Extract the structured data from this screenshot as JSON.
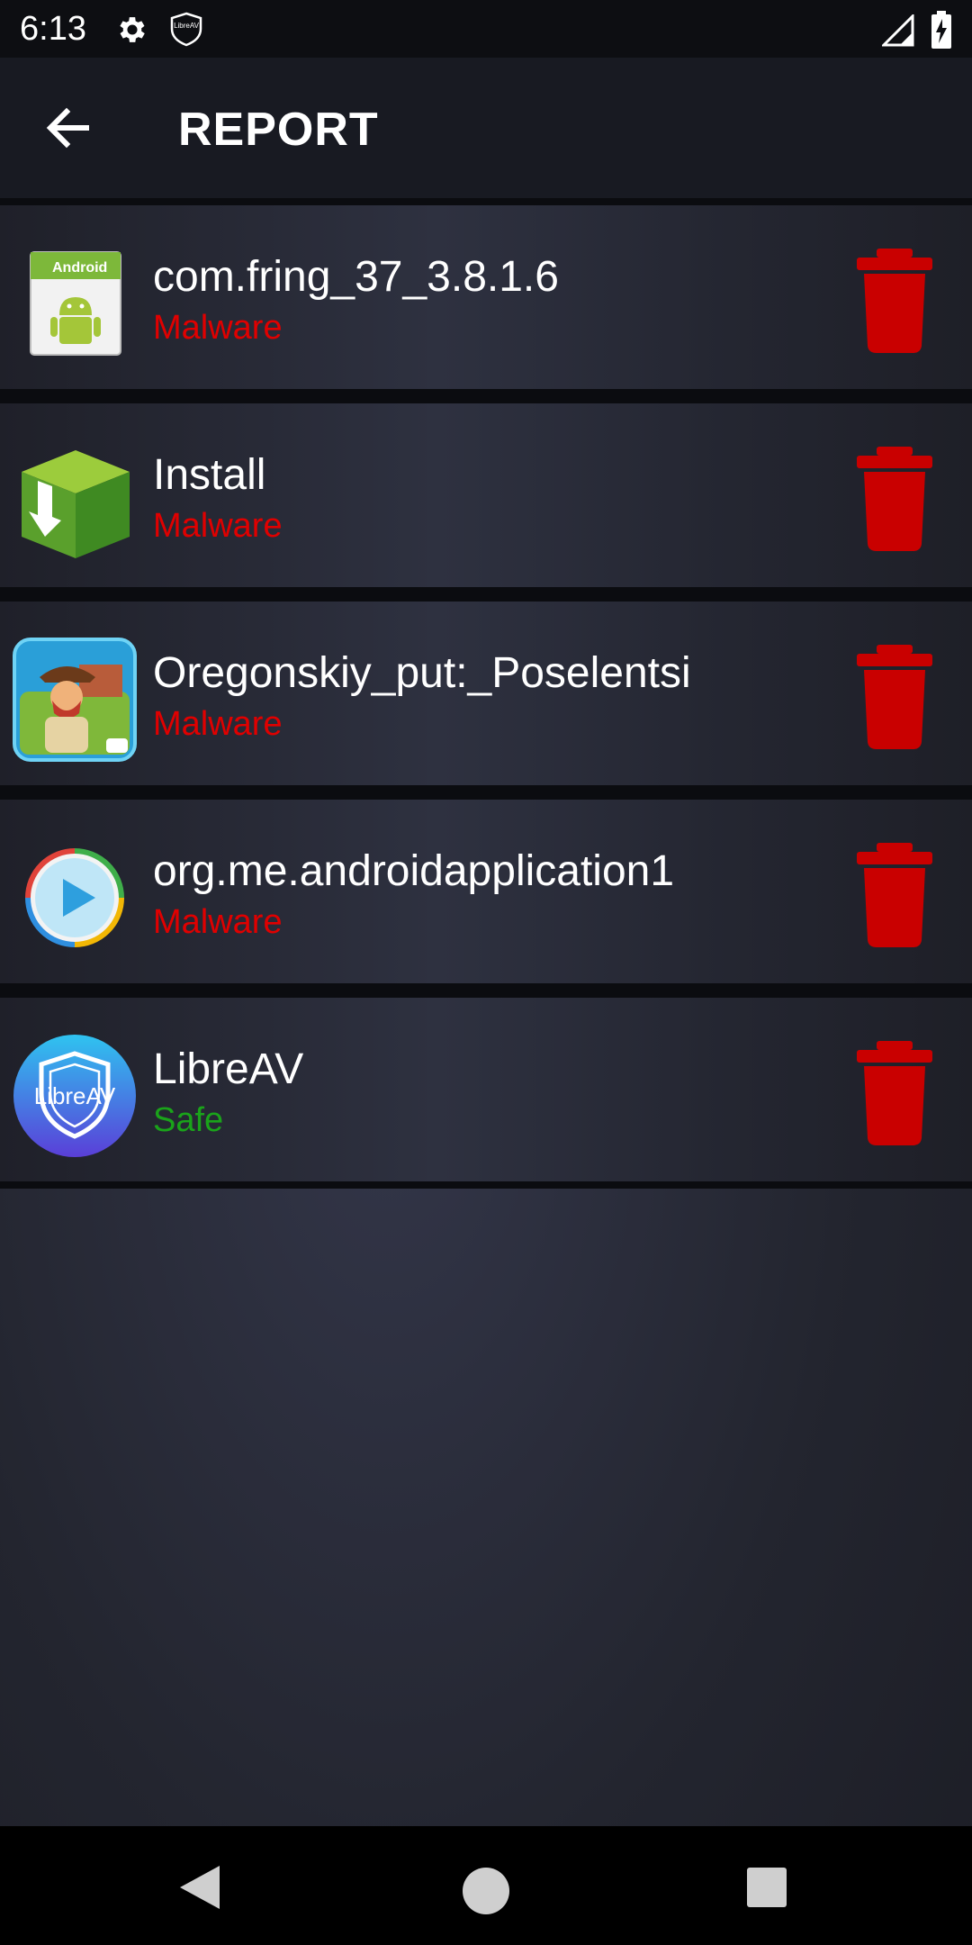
{
  "status_bar": {
    "time": "6:13",
    "icons": [
      "gear-icon",
      "libreav-shield-icon",
      "signal-icon",
      "battery-icon"
    ],
    "shield_text": "LibreAV"
  },
  "app_bar": {
    "back_icon": "arrow-left-icon",
    "title": "REPORT"
  },
  "report": {
    "items": [
      {
        "name": "com.fring_37_3.8.1.6",
        "status": "Malware",
        "icon": "android-apk-icon",
        "icon_text": "Android"
      },
      {
        "name": "Install",
        "status": "Malware",
        "icon": "green-box-install-icon"
      },
      {
        "name": "Oregonskiy_put:_Poselentsi",
        "status": "Malware",
        "icon": "game-cowboy-icon"
      },
      {
        "name": "org.me.androidapplication1",
        "status": "Malware",
        "icon": "play-circle-icon"
      },
      {
        "name": "LibreAV",
        "status": "Safe",
        "icon": "libreav-shield-icon",
        "icon_text": "LibreAV"
      }
    ]
  },
  "colors": {
    "malware": "#e00000",
    "safe": "#1aa31a",
    "delete": "#c90000",
    "app_bar_bg": "#181a22"
  },
  "nav_bar": {
    "icons": [
      "nav-back-icon",
      "nav-home-icon",
      "nav-recents-icon"
    ]
  }
}
